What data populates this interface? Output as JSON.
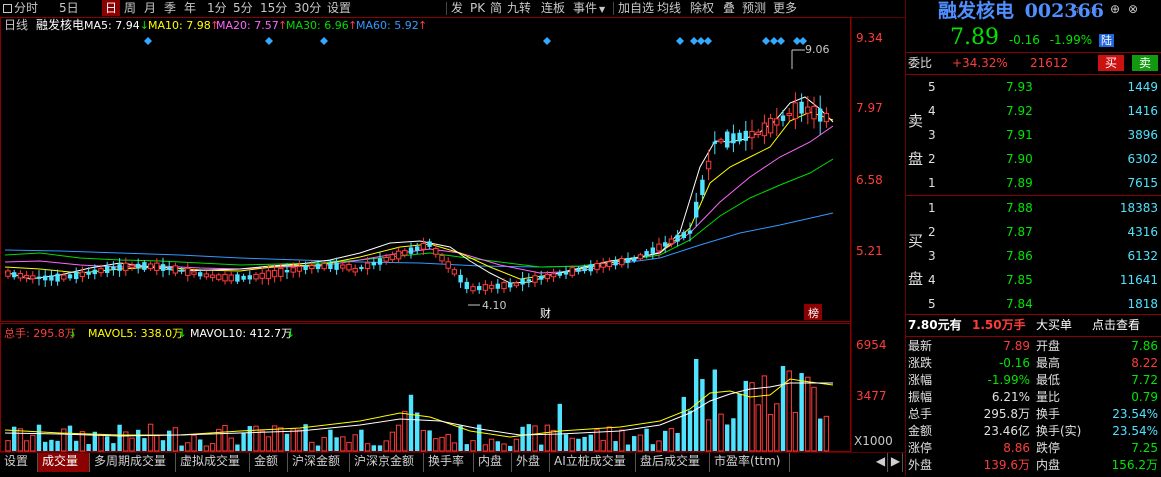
{
  "toolbar": {
    "left": [
      "分时",
      "5日",
      "日",
      "周",
      "月",
      "季",
      "年",
      "1分",
      "5分",
      "15分",
      "30分",
      "设置"
    ],
    "right": [
      "发",
      "PK",
      "简",
      "九转",
      "连板",
      "事件",
      "加自选",
      "均线",
      "除权",
      "叠",
      "预测",
      "更多"
    ],
    "active_index": 2,
    "icons": [
      "gear-icon",
      "power-icon",
      "star-icon",
      "pointer-hand-icon",
      "plus-circle-icon",
      "close-circle-icon"
    ]
  },
  "chart_header": {
    "period": "日线",
    "name": "融发核电",
    "ma": [
      {
        "label": "MA5: 7.94",
        "arrow": "↓",
        "color": "#ffffff"
      },
      {
        "label": "MA10: 7.98",
        "arrow": "↑",
        "color": "#ffff00"
      },
      {
        "label": "MA20: 7.57",
        "arrow": "↑",
        "color": "#ff66ff"
      },
      {
        "label": "MA30: 6.96",
        "arrow": "↑",
        "color": "#00dd00"
      },
      {
        "label": "MA60: 5.92",
        "arrow": "↑",
        "color": "#3399ff"
      }
    ]
  },
  "price_axis": [
    "9.34",
    "7.97",
    "6.58",
    "5.21"
  ],
  "volume_header": {
    "items": [
      {
        "label": "总手: 295.8万",
        "arrow": "↓",
        "color": "#ff3c3c"
      },
      {
        "label": "MAVOL5: 338.0万",
        "arrow": "↓",
        "color": "#ffff00"
      },
      {
        "label": "MAVOL10: 412.7万",
        "arrow": "↓",
        "color": "#ffffff"
      }
    ]
  },
  "volume_axis": [
    "6954",
    "3477",
    "X1000"
  ],
  "annotations": {
    "high": "9.06",
    "low": "4.10",
    "cai": "财",
    "bang": "榜"
  },
  "bottom_tabs": [
    "设置",
    "成交量",
    "多周期成交量",
    "虚拟成交量",
    "金额",
    "沪深金额",
    "沪深京金额",
    "换手率",
    "内盘",
    "外盘",
    "AI立桩成交量",
    "盘后成交量",
    "市盈率(ttm)"
  ],
  "bottom_active": 1,
  "stock": {
    "name": "融发核电",
    "code": "002366",
    "price": "7.89",
    "change": "-0.16",
    "pct": "-1.99%",
    "badge": "陆"
  },
  "weibi": {
    "label": "委比",
    "value": "+34.32%",
    "diff": "21612",
    "buy": "买",
    "sell": "卖"
  },
  "sell_side_label": [
    "卖",
    "盘"
  ],
  "buy_side_label": [
    "买",
    "盘"
  ],
  "sells": [
    {
      "lvl": "5",
      "price": "7.93",
      "vol": "1449"
    },
    {
      "lvl": "4",
      "price": "7.92",
      "vol": "1416"
    },
    {
      "lvl": "3",
      "price": "7.91",
      "vol": "3896"
    },
    {
      "lvl": "2",
      "price": "7.90",
      "vol": "6302"
    },
    {
      "lvl": "1",
      "price": "7.89",
      "vol": "7615"
    }
  ],
  "buys": [
    {
      "lvl": "1",
      "price": "7.88",
      "vol": "18383"
    },
    {
      "lvl": "2",
      "price": "7.87",
      "vol": "4316"
    },
    {
      "lvl": "3",
      "price": "7.86",
      "vol": "6132"
    },
    {
      "lvl": "4",
      "price": "7.85",
      "vol": "11641"
    },
    {
      "lvl": "5",
      "price": "7.84",
      "vol": "1818"
    }
  ],
  "big_order": {
    "a": "7.80元有",
    "b": "1.50万手",
    "c": "大买单",
    "d": "点击查看"
  },
  "quote": [
    {
      "l1": "最新",
      "v1": "7.89",
      "l2": "开盘",
      "v2": "7.86"
    },
    {
      "l1": "涨跌",
      "v1": "-0.16",
      "l2": "最高",
      "v2": "8.22"
    },
    {
      "l1": "涨幅",
      "v1": "-1.99%",
      "l2": "最低",
      "v2": "7.72"
    },
    {
      "l1": "振幅",
      "v1": "6.21%",
      "l2": "量比",
      "v2": "0.79"
    },
    {
      "l1": "总手",
      "v1": "295.8万",
      "l2": "换手",
      "v2": "23.54%"
    },
    {
      "l1": "金额",
      "v1": "23.46亿",
      "l2": "换手(实)",
      "v2": "23.54%"
    },
    {
      "l1": "涨停",
      "v1": "8.86",
      "l2": "跌停",
      "v2": "7.25"
    },
    {
      "l1": "外盘",
      "v1": "139.6万",
      "l2": "内盘",
      "v2": "156.2万"
    }
  ],
  "colors": {
    "up": "#ff3c3c",
    "down": "#4fe3ff",
    "accent": "#8b0000"
  }
}
